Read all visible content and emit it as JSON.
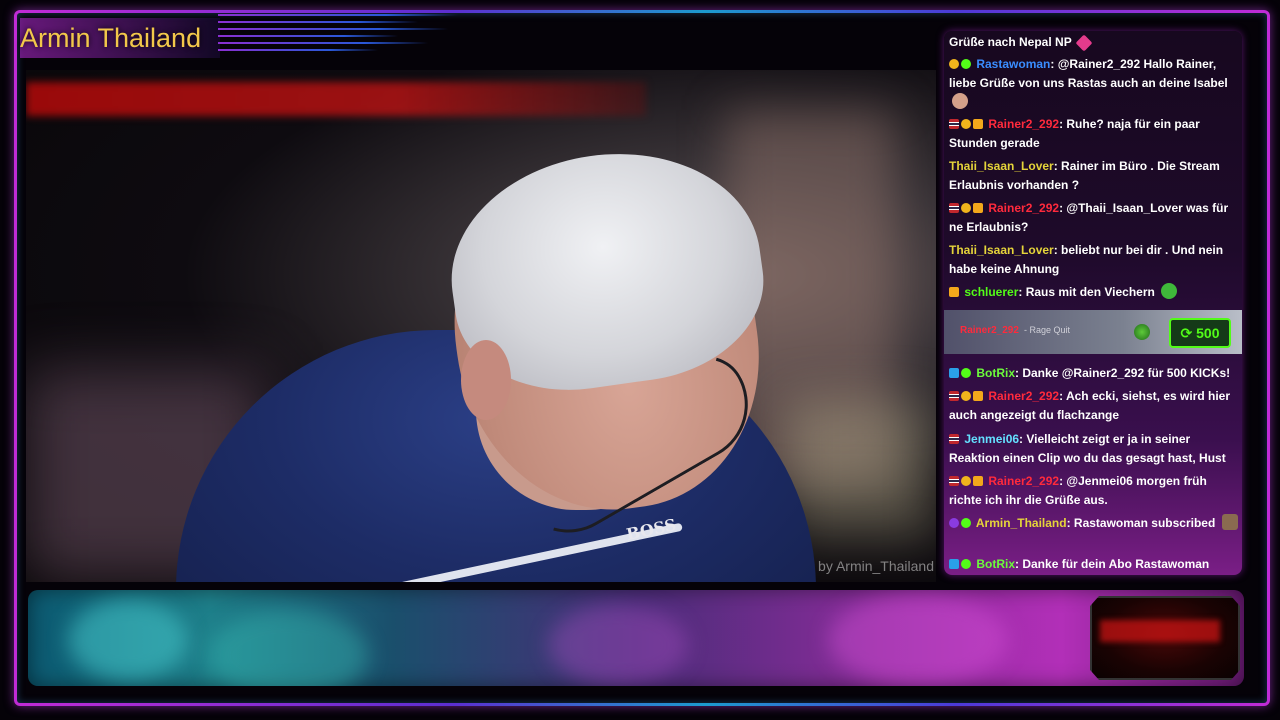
{
  "header": {
    "title": "Armin Thailand"
  },
  "video": {
    "watermark": "by Armin_Thailand",
    "shirt_logo": "BOSS"
  },
  "chat": {
    "messages": [
      {
        "id": "m0",
        "user": "",
        "text": "Grüße nach Nepal NP",
        "badges": [],
        "emote": "heart"
      },
      {
        "id": "m1",
        "user": "Rastawoman",
        "text": ": @Rainer2_292 Hallo Rainer, liebe Grüße von uns Rastas auch an deine Isabel",
        "badges": [
          "gold",
          "green-grid"
        ],
        "color": "#3a8dff",
        "emote": "face"
      },
      {
        "id": "m2",
        "user": "Rainer2_292",
        "text": ": Ruhe? naja für ein paar Stunden gerade",
        "badges": [
          "flag",
          "gold",
          "crown"
        ],
        "color": "#ff2a3c"
      },
      {
        "id": "m3",
        "user": "Thaii_Isaan_Lover",
        "text": ": Rainer im Büro . Die Stream Erlaubnis vorhanden ?",
        "badges": [],
        "color": "#e5d43a"
      },
      {
        "id": "m4",
        "user": "Rainer2_292",
        "text": ": @Thaii_Isaan_Lover was für ne Erlaubnis?",
        "badges": [
          "flag",
          "gold",
          "crown"
        ],
        "color": "#ff2a3c"
      },
      {
        "id": "m5",
        "user": "Thaii_Isaan_Lover",
        "text": ": beliebt nur bei dir . Und nein habe keine Ahnung",
        "badges": [],
        "color": "#e5d43a"
      },
      {
        "id": "m6",
        "user": "schluerer",
        "text": ": Raus mit den Viechern",
        "badges": [
          "crown"
        ],
        "color": "#53fc18",
        "emote": "green"
      },
      {
        "id": "m7",
        "user": "BotRix",
        "text": ": Danke @Rainer2_292 für 500 KICKs!",
        "badges": [
          "blue",
          "green"
        ],
        "color": "#6cfb3b"
      },
      {
        "id": "m8",
        "user": "Rainer2_292",
        "text": ": Ach ecki, siehst, es wird hier auch angezeigt du flachzange",
        "badges": [
          "flag",
          "gold",
          "crown"
        ],
        "color": "#ff2a3c"
      },
      {
        "id": "m9",
        "user": "Jenmei06",
        "text": ": Vielleicht zeigt er ja in seiner Reaktion einen Clip wo du das gesagt hast, Hust",
        "badges": [
          "flag"
        ],
        "color": "#64e0ff"
      },
      {
        "id": "m10",
        "user": "Rainer2_292",
        "text": ": @Jenmei06 morgen früh richte ich ihr die Grüße aus.",
        "badges": [
          "flag",
          "gold",
          "crown"
        ],
        "color": "#ff2a3c"
      },
      {
        "id": "m11",
        "user": "Armin_Thailand",
        "text": ": Rastawoman subscribed",
        "badges": [
          "purple",
          "green"
        ],
        "color": "#e5d43a",
        "emote": "avatar"
      },
      {
        "id": "m12",
        "user": "BotRix",
        "text": ": Danke für dein Abo Rastawoman",
        "badges": [
          "blue",
          "green"
        ],
        "color": "#6cfb3b"
      }
    ],
    "rage_quit": {
      "user": "Rainer2_292",
      "label": "- Rage Quit",
      "amount": "500"
    }
  },
  "colors": {
    "frame_accent": "#c12bd6",
    "kick_green": "#53fc18",
    "title_gold": "#f2c84a"
  }
}
